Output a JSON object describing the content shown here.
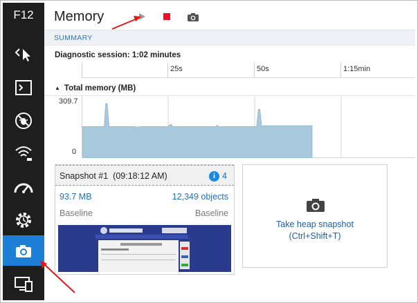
{
  "toolbar": {
    "f12_label": "F12",
    "tools": [
      {
        "icon": "dom-explorer-icon"
      },
      {
        "icon": "console-icon"
      },
      {
        "icon": "debugger-icon"
      },
      {
        "icon": "network-icon"
      },
      {
        "icon": "ui-responsiveness-icon"
      },
      {
        "icon": "profiler-icon"
      },
      {
        "icon": "memory-icon",
        "active": true
      },
      {
        "icon": "emulation-icon"
      }
    ]
  },
  "header": {
    "title": "Memory",
    "buttons": [
      {
        "icon": "play-icon",
        "color": "#9a9a9a"
      },
      {
        "icon": "stop-icon",
        "color": "#e8132b"
      },
      {
        "icon": "camera-icon",
        "color": "#555555"
      }
    ]
  },
  "summary": {
    "label": "SUMMARY",
    "session": "Diagnostic session: 1:02 minutes",
    "ruler_ticks": [
      "25s",
      "50s",
      "1:15min"
    ]
  },
  "graph": {
    "title": "Total memory (MB)",
    "y_max": "309.7",
    "y_min": "0"
  },
  "chart_data": {
    "type": "area",
    "title": "Total memory (MB)",
    "xlabel": "",
    "ylabel": "",
    "xlim": [
      0,
      90
    ],
    "ylim": [
      0,
      309.7
    ],
    "x": [
      0,
      5,
      5.9,
      6.3,
      6.7,
      7.2,
      14,
      15,
      15.5,
      23,
      23.8,
      24.5,
      36,
      36.4,
      36.8,
      47,
      47.5,
      47.9,
      48.4,
      49,
      62
    ],
    "values": [
      157,
      157,
      157,
      272,
      272,
      157,
      157,
      154,
      157,
      157,
      169,
      157,
      157,
      164,
      157,
      157,
      243,
      243,
      157,
      161,
      161
    ],
    "color": "#a8c8dc"
  },
  "snapshot": {
    "title": "Snapshot #1",
    "time": "(09:18:12 AM)",
    "info_count": "4",
    "size": "93.7 MB",
    "objects": "12,349 objects",
    "size_baseline": "Baseline",
    "objects_baseline": "Baseline"
  },
  "take_snapshot": {
    "line1": "Take heap snapshot",
    "line2": "(Ctrl+Shift+T)"
  },
  "colors": {
    "sidebar_bg": "#1e1e1e",
    "active_tool": "#1e7fd6",
    "accent_link": "#1e6fc0",
    "annotation_arrow": "#e01818"
  }
}
